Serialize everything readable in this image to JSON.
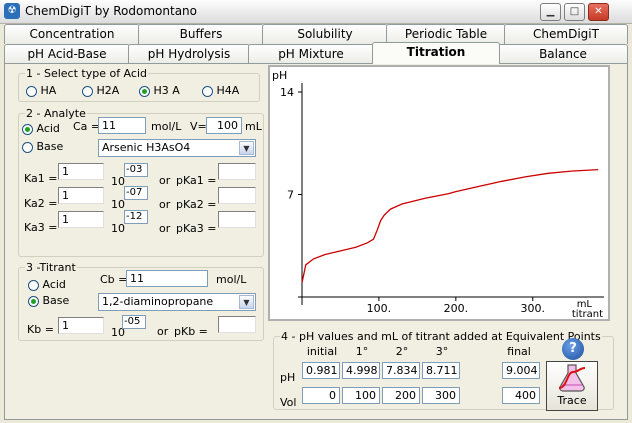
{
  "window": {
    "title": "ChemDigiT by Rodomontano"
  },
  "tabs_row1": [
    "Concentration",
    "Buffers",
    "Solubility",
    "Periodic Table",
    "ChemDigiT"
  ],
  "tabs_row2": [
    "pH Acid-Base",
    "pH Hydrolysis",
    "pH Mixture",
    "Titration",
    "Balance"
  ],
  "active_tab": "Titration",
  "acid_type": {
    "legend": "1 - Select type of Acid",
    "options": [
      "HA",
      "H2A",
      "H3 A",
      "H4A"
    ],
    "selected": "H3 A"
  },
  "analyte": {
    "legend": "2 - Analyte",
    "acid_label": "Acid",
    "base_label": "Base",
    "selected": "Acid",
    "ca_label": "Ca =",
    "ca_value": "11",
    "ca_unit": "mol/L",
    "v_label": "V=",
    "v_value": "100",
    "v_unit": "mL",
    "compound": "Arsenic H3AsO4",
    "ka": [
      {
        "label": "Ka1 =",
        "value": "1",
        "base": "10",
        "exp": "-03",
        "or": "or",
        "pk_label": "pKa1 =",
        "pk_value": ""
      },
      {
        "label": "Ka2 =",
        "value": "1",
        "base": "10",
        "exp": "-07",
        "or": "or",
        "pk_label": "pKa2 =",
        "pk_value": ""
      },
      {
        "label": "Ka3 =",
        "value": "1",
        "base": "10",
        "exp": "-12",
        "or": "or",
        "pk_label": "pKa3 =",
        "pk_value": ""
      }
    ]
  },
  "titrant": {
    "legend": "3 -Titrant",
    "cb_label": "Cb =",
    "cb_value": "11",
    "cb_unit": "mol/L",
    "acid_label": "Acid",
    "base_label": "Base",
    "selected": "Base",
    "compound": "1,2-diaminopropane",
    "kb_label": "Kb =",
    "kb_value": "1",
    "kb_base": "10",
    "kb_exp": "-05",
    "or": "or",
    "pkb_label": "pKb =",
    "pkb_value": ""
  },
  "chart_data": {
    "type": "line",
    "title": "",
    "ylabel": "pH",
    "xlabel": "mL titrant",
    "x_ticks": [
      "100.",
      "200.",
      "300."
    ],
    "y_ticks": [
      "14",
      "7"
    ],
    "xlim": [
      0,
      390
    ],
    "ylim": [
      0,
      14
    ],
    "series": [
      {
        "color": "#cc0000",
        "x": [
          0,
          5,
          15,
          30,
          50,
          70,
          85,
          93,
          98,
          102,
          107,
          115,
          130,
          160,
          190,
          200,
          230,
          260,
          290,
          320,
          350,
          385
        ],
        "y": [
          0.98,
          2.2,
          2.6,
          2.9,
          3.15,
          3.4,
          3.7,
          3.95,
          4.6,
          5.2,
          5.6,
          6.0,
          6.35,
          6.75,
          7.05,
          7.2,
          7.55,
          7.9,
          8.2,
          8.45,
          8.6,
          8.7
        ]
      }
    ]
  },
  "equivalent": {
    "legend": "4 - pH values and mL of titrant added at Equivalent Points",
    "headers": [
      "initial",
      "1°",
      "2°",
      "3°",
      "final"
    ],
    "ph_label": "pH",
    "vol_label": "Vol",
    "ph_values": [
      "0.981",
      "4.998",
      "7.834",
      "8.711",
      "9.004"
    ],
    "vol_values": [
      "0",
      "100",
      "200",
      "300",
      "400"
    ],
    "help_label": "?",
    "trace_label": "Trace"
  },
  "colors": {
    "curve": "#cc0000",
    "accent": "#21a121"
  }
}
